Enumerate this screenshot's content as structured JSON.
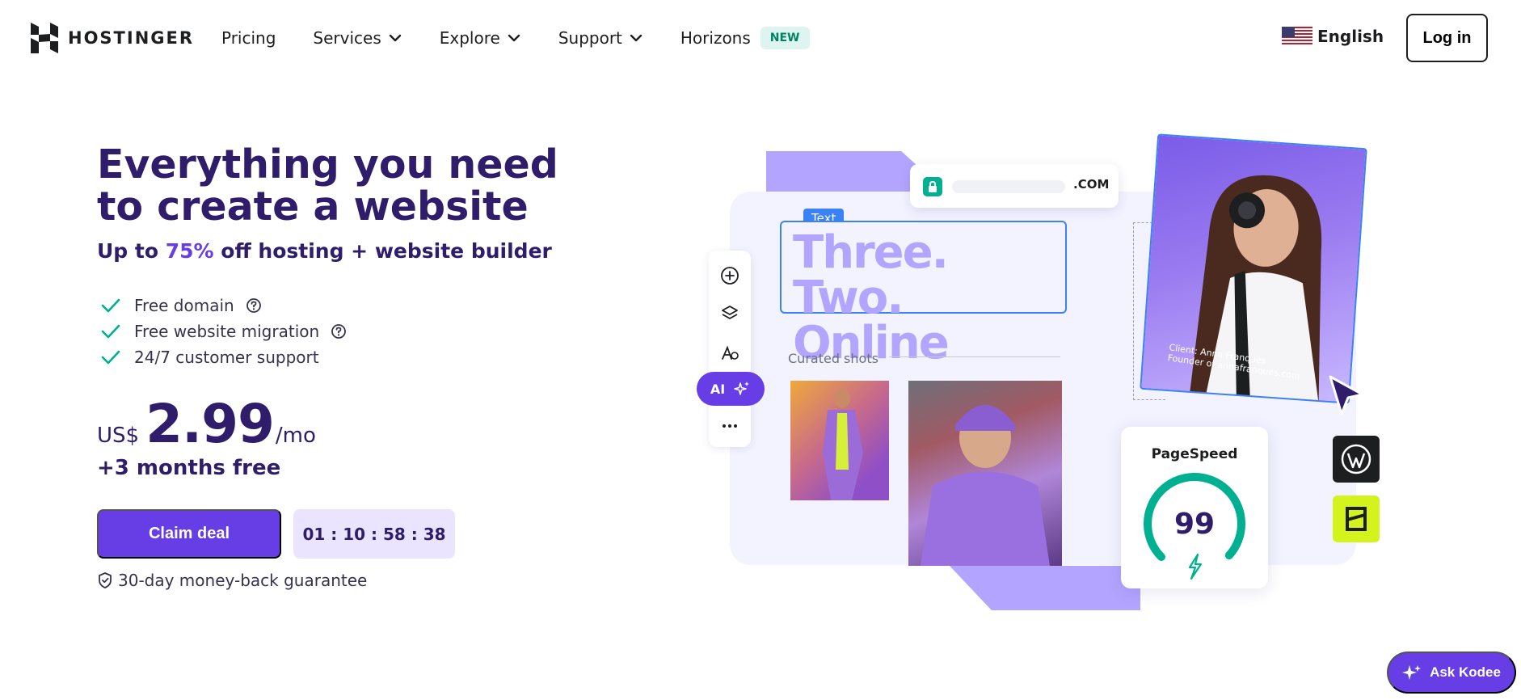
{
  "brand": {
    "name": "HOSTINGER"
  },
  "nav": {
    "links": [
      {
        "label": "Pricing",
        "dropdown": false
      },
      {
        "label": "Services",
        "dropdown": true
      },
      {
        "label": "Explore",
        "dropdown": true
      },
      {
        "label": "Support",
        "dropdown": true
      },
      {
        "label": "Horizons",
        "dropdown": false
      }
    ],
    "new_badge": "NEW",
    "language": "English",
    "login": "Log in"
  },
  "hero": {
    "title": "Everything you need to create a website",
    "subtitle_prefix": "Up to ",
    "subtitle_highlight": "75%",
    "subtitle_suffix": " off hosting + website builder",
    "features": [
      {
        "text": "Free domain",
        "has_info": true
      },
      {
        "text": "Free website migration",
        "has_info": true
      },
      {
        "text": "24/7 customer support",
        "has_info": false
      }
    ],
    "price": {
      "currency": "US$",
      "amount": "2.99",
      "period": "/mo"
    },
    "bonus": "+3 months free",
    "cta": "Claim deal",
    "timer": "01 : 10 : 58 : 38",
    "guarantee": "30-day money-back guarantee"
  },
  "illustration": {
    "domain_tld": ".COM",
    "text_tag": "Text",
    "headline": "Three. Two. Online",
    "ai_label": "AI",
    "curated_label": "Curated shots",
    "photo_caption_line1": "Client: Anna Franques",
    "photo_caption_line2": "Founder of annafranques.com",
    "pagespeed_label": "PageSpeed",
    "pagespeed_score": "99"
  },
  "assistant": {
    "label": "Ask Kodee"
  },
  "colors": {
    "brand_purple": "#673de6",
    "dark_purple": "#2f1c6a",
    "light_purple": "#b3a4ff",
    "green": "#00b090",
    "pagespeed_score_value": 99
  }
}
